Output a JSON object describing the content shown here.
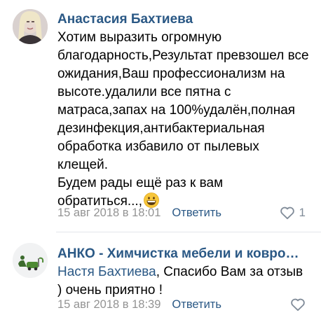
{
  "comments": [
    {
      "author": "Анастасия Бахтиева",
      "text": "Хотим выразить огромную благодарность,Результат превзошел все ожидания,Ваш профессионализм на высоте.удалили все пятна с матраса,запах на 100%удалён,полная дезинфекция,антибактериальная обработка избавило от пылевых клещей.\nБудем рады ещё раз к вам обратиться...,",
      "date": "15 авг 2018 в 18:01",
      "reply_label": "Ответить",
      "likes": "1"
    },
    {
      "author": "АНКО - Химчистка мебели и ковров Саратов",
      "reply_to": "Настя Бахтиева",
      "text": ", Спасибо Вам за отзыв ) очень приятно !",
      "date": "15 авг 2018 в 18:39",
      "reply_label": "Ответить"
    }
  ],
  "icons": {
    "emoji": "grinning-face",
    "like": "heart-outline"
  },
  "colors": {
    "link": "#2a5885",
    "meta": "#939393",
    "icon": "#818c99"
  }
}
